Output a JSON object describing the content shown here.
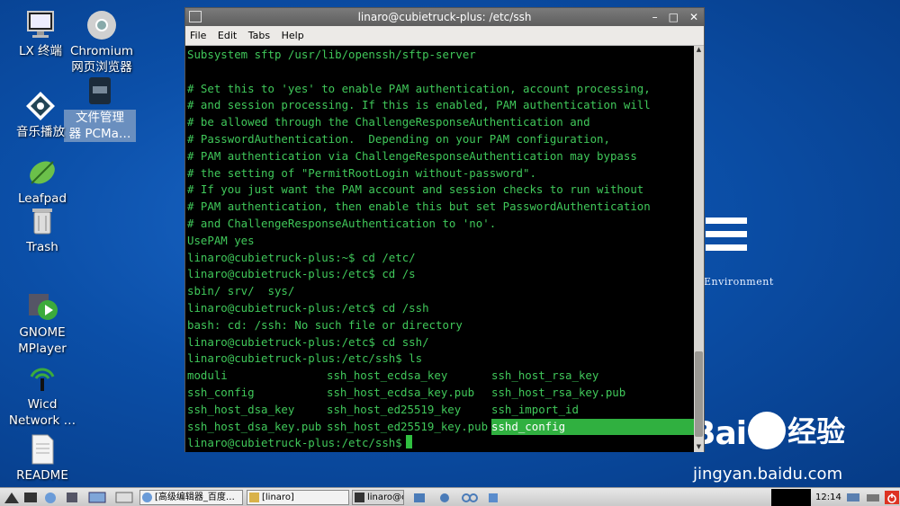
{
  "desktop": {
    "icons": [
      {
        "label": "LX 终端"
      },
      {
        "label": "Chromium\n网页浏览器"
      },
      {
        "label": "文件管理\n器 PCMa…"
      },
      {
        "label": "音乐播放"
      },
      {
        "label": "Leafpad"
      },
      {
        "label": "Trash"
      },
      {
        "label": "GNOME\nMPlayer"
      },
      {
        "label": "Wicd\nNetwork …"
      },
      {
        "label": "README"
      }
    ],
    "wallpaper_text": "Environment"
  },
  "terminal": {
    "title": "linaro@cubietruck-plus: /etc/ssh",
    "menu": [
      "File",
      "Edit",
      "Tabs",
      "Help"
    ],
    "lines": [
      "Subsystem sftp /usr/lib/openssh/sftp-server",
      "",
      "# Set this to 'yes' to enable PAM authentication, account processing,",
      "# and session processing. If this is enabled, PAM authentication will",
      "# be allowed through the ChallengeResponseAuthentication and",
      "# PasswordAuthentication.  Depending on your PAM configuration,",
      "# PAM authentication via ChallengeResponseAuthentication may bypass",
      "# the setting of \"PermitRootLogin without-password\".",
      "# If you just want the PAM account and session checks to run without",
      "# PAM authentication, then enable this but set PasswordAuthentication",
      "# and ChallengeResponseAuthentication to 'no'.",
      "UsePAM yes",
      "linaro@cubietruck-plus:~$ cd /etc/",
      "linaro@cubietruck-plus:/etc$ cd /s",
      "sbin/ srv/  sys/",
      "linaro@cubietruck-plus:/etc$ cd /ssh",
      "bash: cd: /ssh: No such file or directory",
      "linaro@cubietruck-plus:/etc$ cd ssh/",
      "linaro@cubietruck-plus:/etc/ssh$ ls"
    ],
    "ls_output": [
      "moduli",
      "ssh_host_ecdsa_key",
      "ssh_host_rsa_key",
      "ssh_config",
      "ssh_host_ecdsa_key.pub",
      "ssh_host_rsa_key.pub",
      "ssh_host_dsa_key",
      "ssh_host_ed25519_key",
      "ssh_import_id",
      "ssh_host_dsa_key.pub",
      "ssh_host_ed25519_key.pub",
      "sshd_config"
    ],
    "highlighted_file": "sshd_config",
    "prompt": "linaro@cubietruck-plus:/etc/ssh$"
  },
  "watermark": {
    "logo_a": "Bai",
    "logo_b": "经验",
    "url": "jingyan.baidu.com"
  },
  "taskbar": {
    "tasks": [
      "[高级编辑器_百度…",
      "[linaro]",
      "linaro@c"
    ],
    "clock": "12:14"
  },
  "colors": {
    "terminal_text": "#40c85a",
    "highlight": "#30b040",
    "desktop": "#0b4fa8"
  }
}
